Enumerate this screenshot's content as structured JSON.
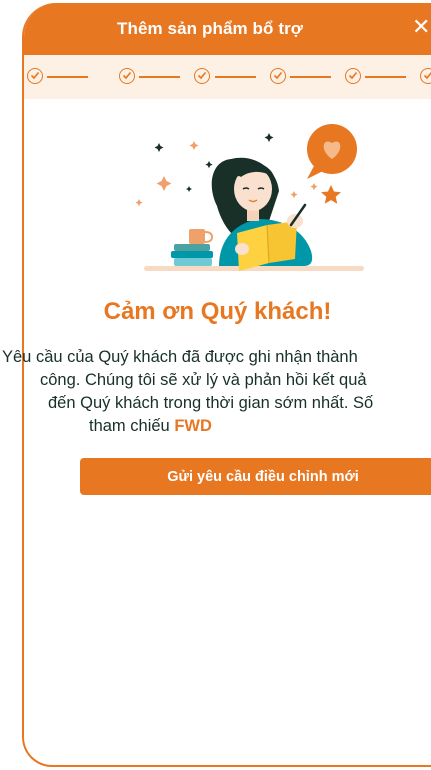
{
  "colors": {
    "brand_orange": "#e87722",
    "stepper_bg": "#fdf0e4",
    "text_dark": "#183028"
  },
  "header": {
    "title": "Thêm sản phẩm bổ trợ",
    "close_icon": "close-icon"
  },
  "stepper": {
    "steps_completed": 6,
    "step_icon": "check-circle-icon"
  },
  "confirmation": {
    "title": "Cảm ơn Quý khách!",
    "message_lines": [
      "Yêu cầu của Quý khách đã được ghi nhận thành",
      "công. Chúng tôi sẽ xử lý và phản hồi kết quả",
      "đến Quý khách trong thời gian sớm nhất. Số",
      "tham chiếu"
    ],
    "reference_code": "FWD"
  },
  "actions": {
    "new_request_label": "Gửi yêu cầu điều chỉnh mới"
  }
}
